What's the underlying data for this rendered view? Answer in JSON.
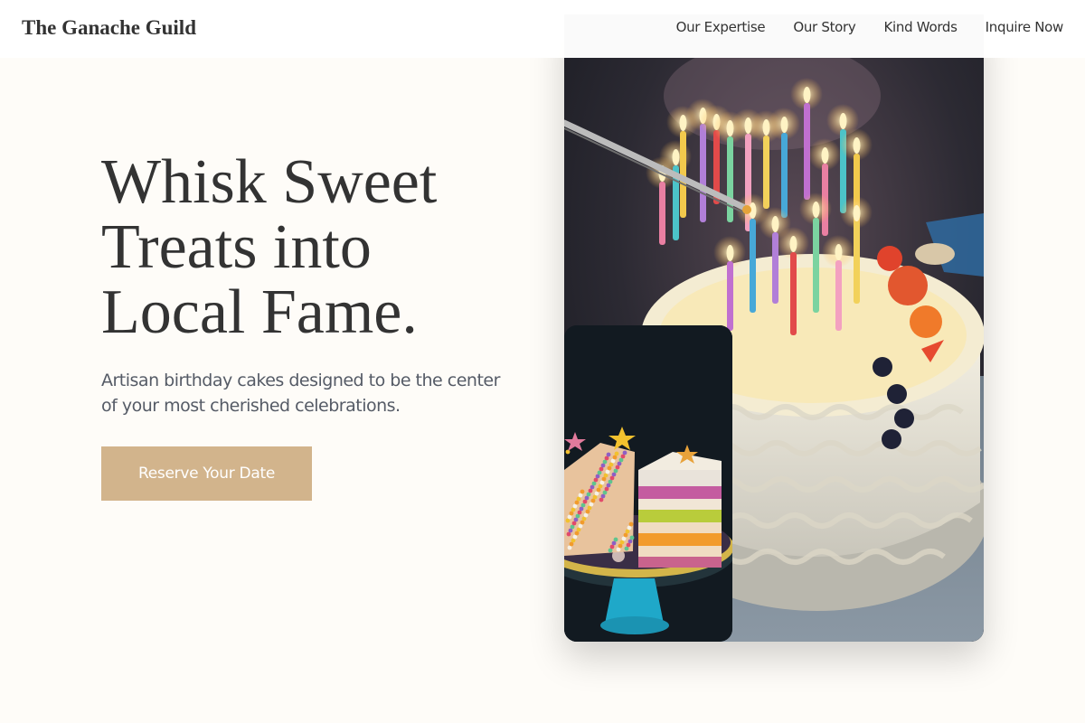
{
  "header": {
    "brand": "The Ganache Guild",
    "nav": [
      {
        "label": "Our Expertise"
      },
      {
        "label": "Our Story"
      },
      {
        "label": "Kind Words"
      },
      {
        "label": "Inquire Now"
      }
    ]
  },
  "hero": {
    "title_lines": [
      "Whisk Sweet",
      "Treats into",
      "Local Fame."
    ],
    "subtitle_lines": [
      "Artisan birthday cakes designed to be the center",
      "of your most cherished celebrations."
    ],
    "cta_label": "Reserve Your Date"
  },
  "images": {
    "main": "birthday-cake-with-lit-candles-photo",
    "side": "sliced-rainbow-layer-cake-photo"
  },
  "colors": {
    "background": "#fefcf8",
    "accent": "#d2b48c",
    "text": "#333333",
    "subtext": "#555b66"
  }
}
